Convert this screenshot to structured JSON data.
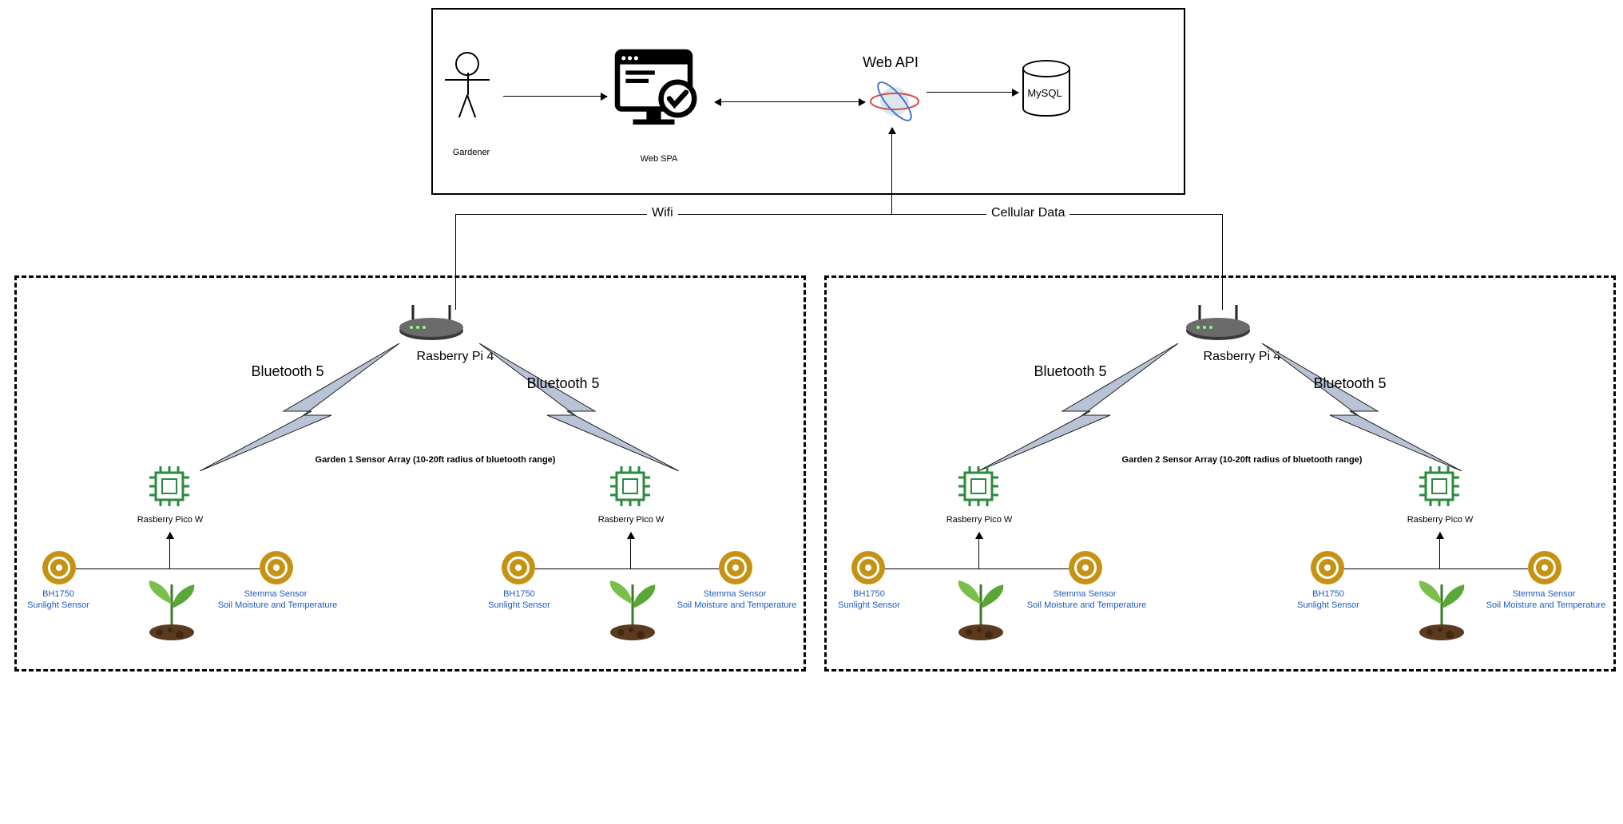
{
  "top": {
    "gardener": "Gardener",
    "web_spa": "Web SPA",
    "web_api": "Web API",
    "mysql": "MySQL",
    "wifi": "Wifi",
    "cellular": "Cellular Data"
  },
  "labels": {
    "raspberry_pi4": "Rasberry Pi 4",
    "bluetooth5": "Bluetooth 5",
    "pico": "Rasberry Pico W",
    "bh1750_line1": "BH1750",
    "bh1750_line2": "Sunlight Sensor",
    "stemma_line1": "Stemma Sensor",
    "stemma_line2": "Soil Moisture and Temperature"
  },
  "garden1": {
    "title": "Garden 1 Sensor Array (10-20ft radius of bluetooth range)"
  },
  "garden2": {
    "title": "Garden 2 Sensor Array (10-20ft radius of bluetooth range)"
  }
}
